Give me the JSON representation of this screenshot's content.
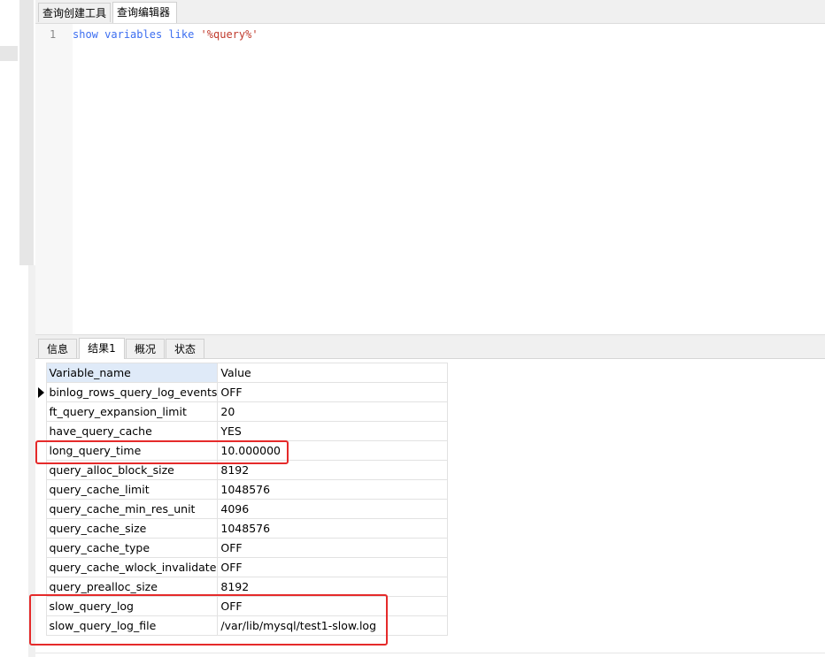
{
  "editor_tabs": [
    {
      "label": "查询创建工具",
      "active": false
    },
    {
      "label": "查询编辑器",
      "active": true
    }
  ],
  "editor": {
    "line_number": "1",
    "code": {
      "kw1": "show",
      "kw2": "variables",
      "kw3": "like",
      "str": "'%query%'"
    }
  },
  "result_tabs": [
    {
      "label": "信息",
      "active": false
    },
    {
      "label": "结果1",
      "active": true
    },
    {
      "label": "概况",
      "active": false
    },
    {
      "label": "状态",
      "active": false
    }
  ],
  "grid": {
    "columns": [
      "Variable_name",
      "Value"
    ],
    "rows": [
      [
        "binlog_rows_query_log_events",
        "OFF"
      ],
      [
        "ft_query_expansion_limit",
        "20"
      ],
      [
        "have_query_cache",
        "YES"
      ],
      [
        "long_query_time",
        "10.000000"
      ],
      [
        "query_alloc_block_size",
        "8192"
      ],
      [
        "query_cache_limit",
        "1048576"
      ],
      [
        "query_cache_min_res_unit",
        "4096"
      ],
      [
        "query_cache_size",
        "1048576"
      ],
      [
        "query_cache_type",
        "OFF"
      ],
      [
        "query_cache_wlock_invalidate",
        "OFF"
      ],
      [
        "query_prealloc_size",
        "8192"
      ],
      [
        "slow_query_log",
        "OFF"
      ],
      [
        "slow_query_log_file",
        "/var/lib/mysql/test1-slow.log"
      ]
    ],
    "current_row": 0
  },
  "colors": {
    "highlight": "#e52a2a",
    "keyword": "#3c6ef0",
    "string": "#c0392b"
  }
}
